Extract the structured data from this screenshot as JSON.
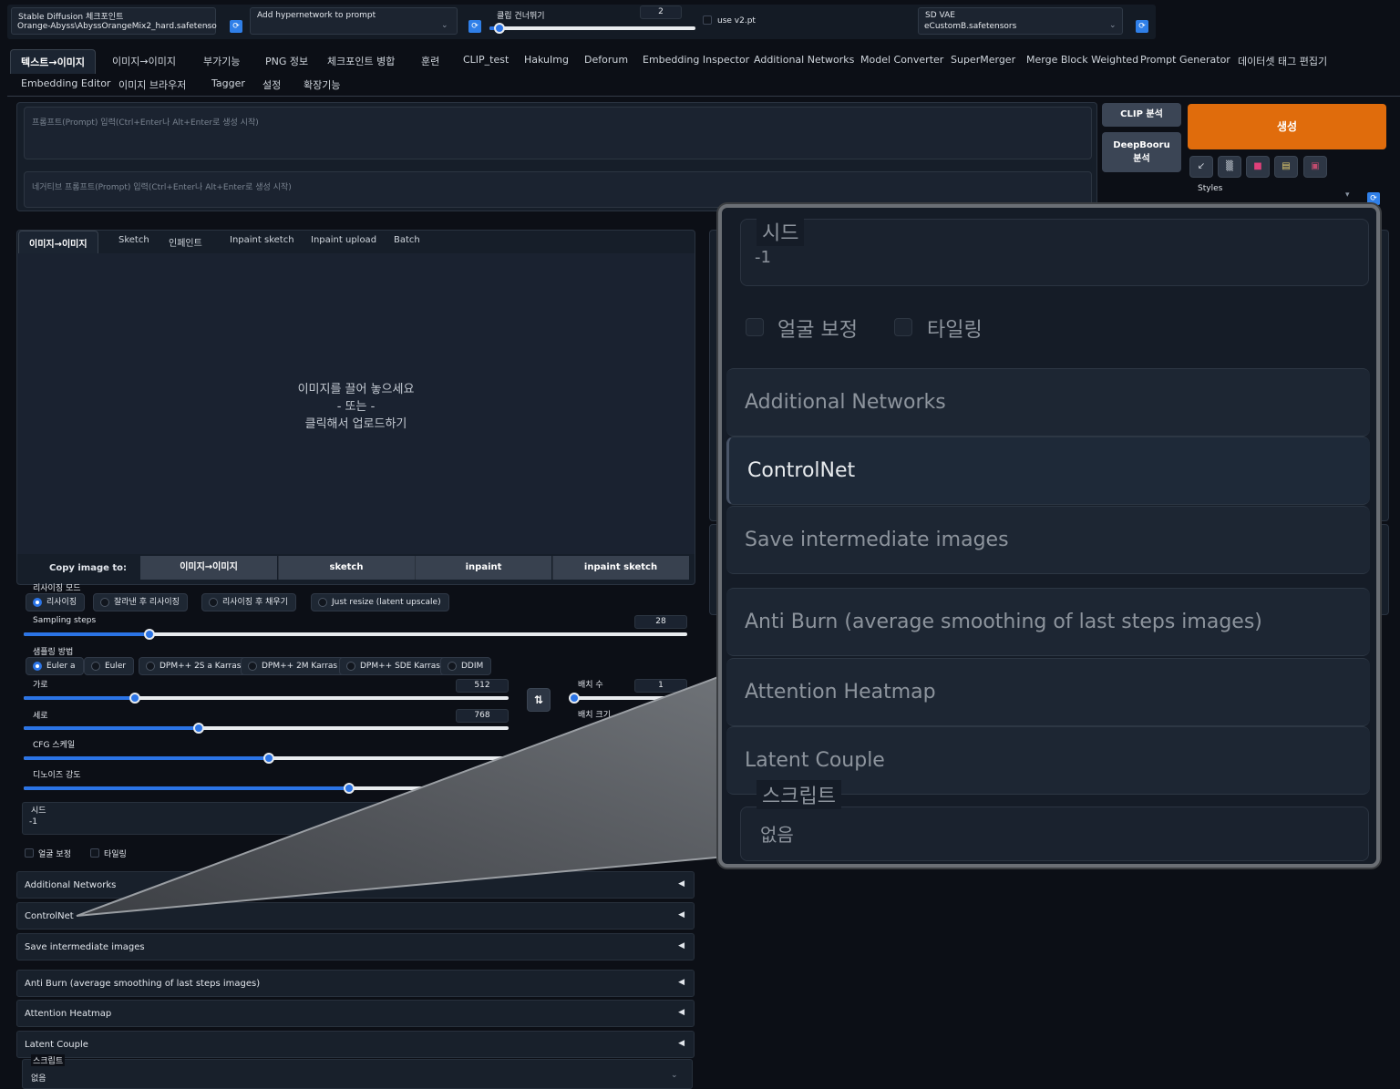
{
  "top": {
    "checkpoint": {
      "label": "Stable Diffusion 체크포인트",
      "value": "Orange-Abyss\\AbyssOrangeMix2_hard.safetenso"
    },
    "hypernetwork": {
      "label": "Add hypernetwork to prompt",
      "value": ""
    },
    "clip_skip": {
      "label": "클립 건너뛰기",
      "value": "2",
      "fraction": 0.05
    },
    "use_v2": {
      "label": "use v2.pt",
      "checked": false
    },
    "vae": {
      "label": "SD VAE",
      "value": "eCustomB.safetensors"
    },
    "refresh_icon": "refresh-icon"
  },
  "main_tabs": {
    "row1": [
      "텍스트→이미지",
      "이미지→이미지",
      "부가기능",
      "PNG 정보",
      "체크포인트 병합",
      "훈련",
      "CLIP_test",
      "HakuImg",
      "Deforum",
      "Embedding Inspector",
      "Additional Networks",
      "Model Converter",
      "SuperMerger",
      "Merge Block Weighted",
      "Prompt Generator",
      "데이터셋 태그 편집기"
    ],
    "row2": [
      "Embedding Editor",
      "이미지 브라우저",
      "Tagger",
      "설정",
      "확장기능"
    ],
    "selected": "텍스트→이미지"
  },
  "prompt": {
    "placeholder": "프롬프트(Prompt) 입력(Ctrl+Enter나 Alt+Enter로 생성 시작)",
    "negative_placeholder": "네거티브 프롬프트(Prompt) 입력(Ctrl+Enter나 Alt+Enter로 생성 시작)"
  },
  "actions": {
    "clip": "CLIP 분석",
    "deepbooru_line1": "DeepBooru",
    "deepbooru_line2": "분석",
    "generate": "생성",
    "styles_label": "Styles",
    "style_icons": [
      "↙",
      "▒",
      "■",
      "▤",
      "▣"
    ],
    "accent": "#e06c0c"
  },
  "img_tabs": {
    "items": [
      "이미지→이미지",
      "Sketch",
      "인페인트",
      "Inpaint sketch",
      "Inpaint upload",
      "Batch"
    ],
    "selected": "이미지→이미지"
  },
  "upload": {
    "line1": "이미지를 끌어 놓으세요",
    "line2": "- 또는 -",
    "line3": "클릭해서 업로드하기"
  },
  "copy": {
    "label": "Copy image to:",
    "targets": [
      "이미지→이미지",
      "sketch",
      "inpaint",
      "inpaint sketch"
    ]
  },
  "resize": {
    "label": "리사이징 모드",
    "options": [
      "리사이징",
      "잘라낸 후 리사이징",
      "리사이징 후 채우기",
      "Just resize (latent upscale)"
    ],
    "selected": 0
  },
  "sampling_steps": {
    "label": "Sampling steps",
    "value": "28",
    "fraction": 0.19
  },
  "sampler": {
    "label": "샘플링 방법",
    "options": [
      "Euler a",
      "Euler",
      "DPM++ 2S a Karras",
      "DPM++ 2M Karras",
      "DPM++ SDE Karras",
      "DDIM"
    ],
    "selected": 0
  },
  "width": {
    "label": "가로",
    "value": "512",
    "fraction": 0.23
  },
  "height": {
    "label": "세로",
    "value": "768",
    "fraction": 0.36
  },
  "batch_count": {
    "label": "배치 수",
    "value": "1"
  },
  "batch_size": {
    "label": "배치 크기"
  },
  "swap_icon": "⇅",
  "cfg": {
    "label": "CFG 스케일",
    "fraction": 0.37
  },
  "denoise": {
    "label": "디노이즈 강도",
    "fraction": 0.49
  },
  "seed": {
    "label": "시드",
    "value": "-1"
  },
  "restore_faces": "얼굴 보정",
  "tiling": "타일링",
  "accordions": [
    "Additional Networks",
    "ControlNet",
    "Save intermediate images",
    "Anti Burn (average smoothing of last steps images)",
    "Attention Heatmap",
    "Latent Couple"
  ],
  "accordion_arrow": "◀",
  "script": {
    "label": "스크립트",
    "value": "없음"
  },
  "zoom": {
    "seed_label": "시드",
    "seed_value": "-1",
    "restore_faces": "얼굴 보정",
    "tiling": "타일링",
    "items": [
      "Additional Networks",
      "ControlNet",
      "Save intermediate images",
      "Anti Burn (average smoothing of last steps images)",
      "Attention Heatmap",
      "Latent Couple"
    ],
    "script_label": "스크립트",
    "script_value": "없음"
  }
}
